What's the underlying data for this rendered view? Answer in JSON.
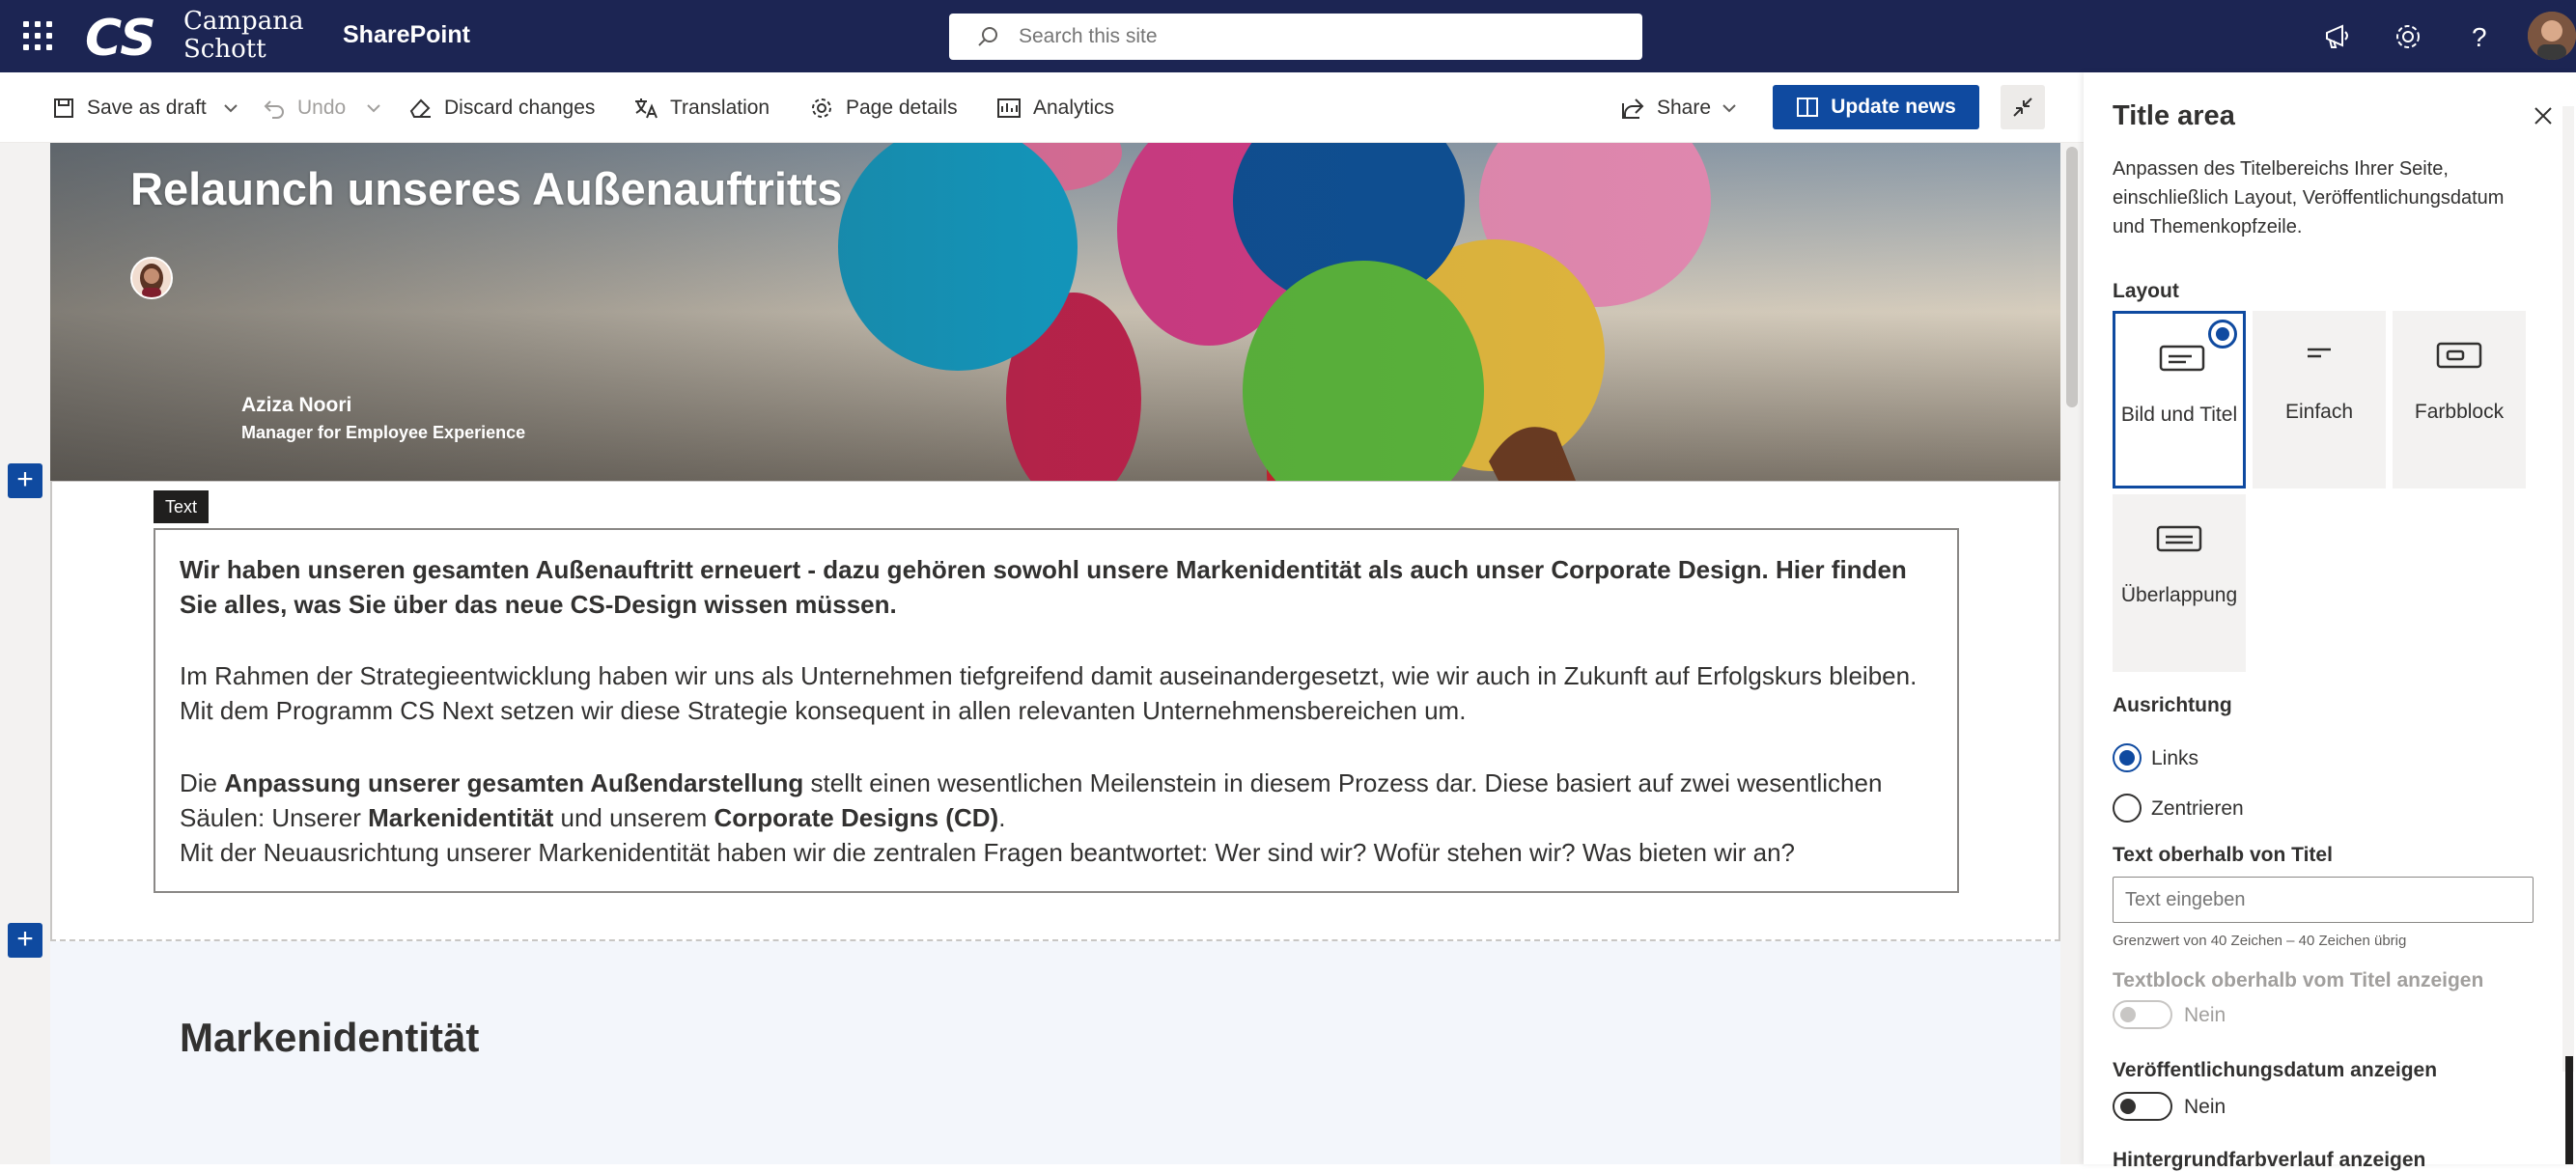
{
  "suite": {
    "logo_line1": "Campana",
    "logo_line2": "Schott",
    "app_name": "SharePoint",
    "search_placeholder": "Search this site"
  },
  "commands": {
    "save_draft": "Save as draft",
    "undo": "Undo",
    "discard": "Discard changes",
    "translation": "Translation",
    "page_details": "Page details",
    "analytics": "Analytics",
    "share": "Share",
    "update_news": "Update news"
  },
  "hero": {
    "title": "Relaunch unseres Außenauftritts",
    "author_name": "Aziza Noori",
    "author_role": "Manager for Employee Experience"
  },
  "text_webpart": {
    "tag": "Text",
    "p1": "Wir haben unseren gesamten Außenauftritt erneuert - dazu gehören sowohl unsere Markenidentität als auch unser Corporate Design. Hier finden Sie alles, was Sie über das neue CS-Design wissen müssen.",
    "p2": "Im Rahmen der Strategieentwicklung haben wir uns als Unternehmen tiefgreifend damit auseinandergesetzt, wie wir auch in Zukunft auf Erfolgskurs bleiben. Mit dem Programm CS Next setzen wir diese Strategie konsequent in allen relevanten Unternehmensbereichen um.",
    "p3_a": "Die ",
    "p3_b": "Anpassung unserer gesamten Außendarstellung",
    "p3_c": " stellt einen wesentlichen Meilenstein in diesem Prozess dar. Diese basiert auf zwei wesentlichen Säulen: Unserer ",
    "p3_d": "Markenidentität",
    "p3_e": " und unserem ",
    "p3_f": "Corporate Designs (CD)",
    "p3_g": ".",
    "p4": "Mit der Neuausrichtung unserer Markenidentität haben wir die zentralen Fragen beantwortet: Wer sind wir? Wofür stehen wir? Was bieten wir an?"
  },
  "section2": {
    "title": "Markenidentität"
  },
  "pane": {
    "title": "Title area",
    "description": "Anpassen des Titelbereichs Ihrer Seite, einschließlich Layout, Veröffentlichungsdatum und Themenkopfzeile.",
    "layout_label": "Layout",
    "layouts": [
      "Bild und Titel",
      "Einfach",
      "Farbblock",
      "Überlappung"
    ],
    "alignment_label": "Ausrichtung",
    "align_left": "Links",
    "align_center": "Zentrieren",
    "text_above_label": "Text oberhalb von Titel",
    "text_above_placeholder": "Text eingeben",
    "text_above_hint": "Grenzwert von 40 Zeichen – 40 Zeichen übrig",
    "textblock_label": "Textblock oberhalb vom Titel anzeigen",
    "textblock_value": "Nein",
    "pubdate_label": "Veröffentlichungsdatum anzeigen",
    "pubdate_value": "Nein",
    "gradient_label": "Hintergrundfarbverlauf anzeigen"
  },
  "colors": {
    "suite_bar": "#1c2553",
    "accent": "#0f4aa0"
  }
}
